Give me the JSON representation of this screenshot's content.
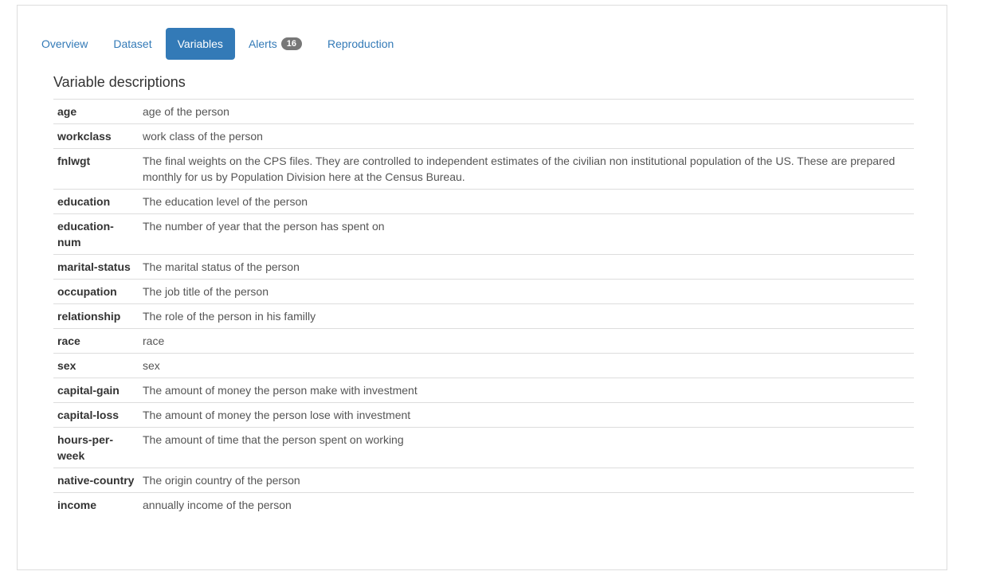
{
  "tabs": [
    {
      "label": "Overview",
      "active": false
    },
    {
      "label": "Dataset",
      "active": false
    },
    {
      "label": "Variables",
      "active": true
    },
    {
      "label": "Alerts",
      "badge": "16",
      "active": false
    },
    {
      "label": "Reproduction",
      "active": false
    }
  ],
  "section": {
    "title": "Variable descriptions"
  },
  "variables": [
    {
      "name": "age",
      "description": "age of the person"
    },
    {
      "name": "workclass",
      "description": "work class of the person"
    },
    {
      "name": "fnlwgt",
      "description": "The final weights on the CPS files. They are controlled to independent estimates of the civilian non institutional population of the US. These are prepared monthly for us by Population Division here at the Census Bureau."
    },
    {
      "name": "education",
      "description": "The education level of the person"
    },
    {
      "name": "education-num",
      "description": "The number of year that the person has spent on"
    },
    {
      "name": "marital-status",
      "description": "The marital status of the person"
    },
    {
      "name": "occupation",
      "description": "The job title of the person"
    },
    {
      "name": "relationship",
      "description": "The role of the person in his familly"
    },
    {
      "name": "race",
      "description": "race"
    },
    {
      "name": "sex",
      "description": "sex"
    },
    {
      "name": "capital-gain",
      "description": "The amount of money the person make with investment"
    },
    {
      "name": "capital-loss",
      "description": "The amount of money the person lose with investment"
    },
    {
      "name": "hours-per-week",
      "description": "The amount of time that the person spent on working"
    },
    {
      "name": "native-country",
      "description": "The origin country of the person"
    },
    {
      "name": "income",
      "description": "annually income of the person"
    }
  ],
  "colors": {
    "accent": "#337ab7",
    "badge": "#777777",
    "border": "#dddddd"
  }
}
